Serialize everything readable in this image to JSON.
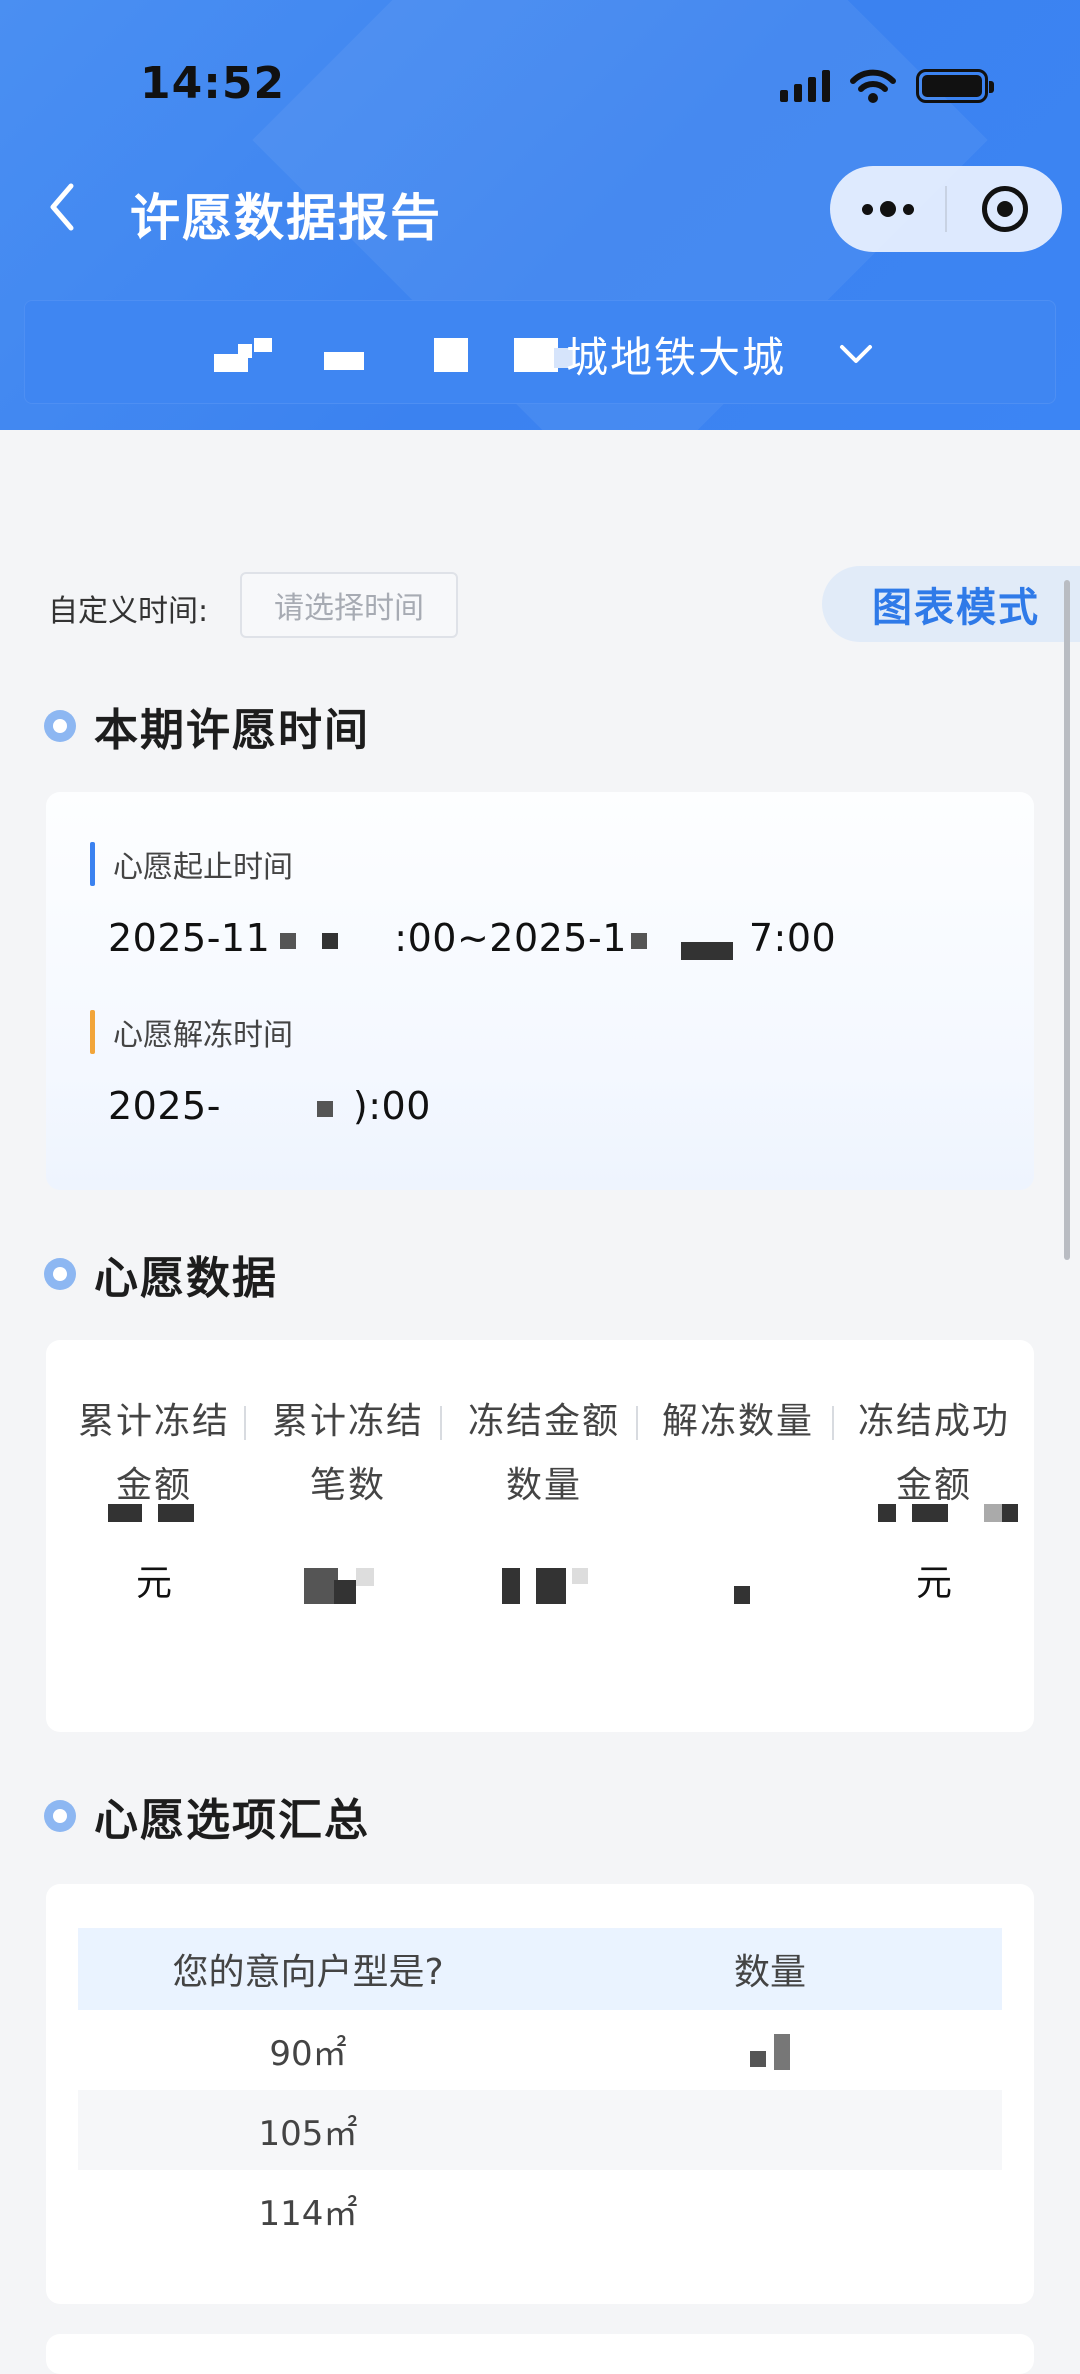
{
  "status_bar": {
    "time": "14:52"
  },
  "nav": {
    "title": "许愿数据报告"
  },
  "project": {
    "name": "城地铁大城"
  },
  "filter": {
    "label": "自定义时间:",
    "placeholder": "请选择时间",
    "mode_button": "图表模式"
  },
  "period": {
    "section_title": "本期许愿时间",
    "wish_range_label": "心愿起止时间",
    "wish_range_value_start": "2025-11",
    "wish_range_value_mid": ":00~2025-1",
    "wish_range_value_end": "7:00",
    "unfreeze_label": "心愿解冻时间",
    "unfreeze_value_start": "2025-",
    "unfreeze_value_end": "):00",
    "colors": {
      "range_bar": "#3b82f0",
      "unfreeze_bar": "#f2a53a"
    }
  },
  "wish_data": {
    "section_title": "心愿数据",
    "columns": [
      {
        "label": "累计冻结金额",
        "unit": "元"
      },
      {
        "label": "累计冻结笔数",
        "unit": ""
      },
      {
        "label": "冻结金额数量",
        "unit": ""
      },
      {
        "label": "解冻数量",
        "unit": ""
      },
      {
        "label": "冻结成功金额",
        "unit": "元"
      }
    ]
  },
  "options": {
    "section_title": "心愿选项汇总",
    "headers": [
      "您的意向户型是?",
      "数量"
    ],
    "rows": [
      {
        "type": "90㎡"
      },
      {
        "type": "105㎡"
      },
      {
        "type": "114㎡"
      }
    ]
  }
}
